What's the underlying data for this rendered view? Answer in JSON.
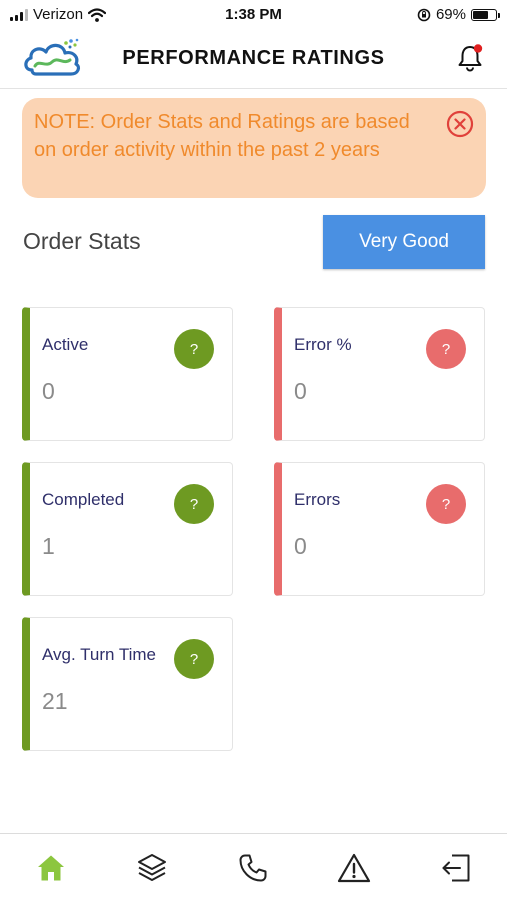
{
  "status_bar": {
    "carrier": "Verizon",
    "time": "1:38 PM",
    "battery_percent": "69%",
    "battery_level": 0.69,
    "icons": [
      "signal-icon",
      "wifi-icon",
      "orientation-lock-icon",
      "battery-icon"
    ]
  },
  "header": {
    "title": "PERFORMANCE RATINGS",
    "logo_icon": "cloud-logo-icon",
    "notification_icon": "bell-icon",
    "has_unread": true
  },
  "note": {
    "text": "NOTE: Order Stats and Ratings are based on order activity within the past 2 years",
    "close_icon": "close-circle-icon"
  },
  "order_stats": {
    "title": "Order Stats",
    "rating_label": "Very Good",
    "cards": [
      {
        "label": "Active",
        "value": "0",
        "help": "?",
        "status": "good"
      },
      {
        "label": "Error %",
        "value": "0",
        "help": "?",
        "status": "bad"
      },
      {
        "label": "Completed",
        "value": "1",
        "help": "?",
        "status": "good"
      },
      {
        "label": "Errors",
        "value": "0",
        "help": "?",
        "status": "bad"
      },
      {
        "label": "Avg. Turn Time",
        "value": "21",
        "help": "?",
        "status": "good"
      }
    ]
  },
  "bottom_nav": {
    "items": [
      {
        "icon": "home-icon",
        "active": true
      },
      {
        "icon": "layers-icon",
        "active": false
      },
      {
        "icon": "phone-icon",
        "active": false
      },
      {
        "icon": "warning-icon",
        "active": false
      },
      {
        "icon": "logout-icon",
        "active": false
      }
    ]
  },
  "colors": {
    "good": "#6e9a22",
    "bad": "#e86c6c",
    "accent_blue": "#4a90e2",
    "note_background": "#fbd4b4",
    "note_text": "#f08a2c",
    "nav_active": "#8cc63f"
  }
}
